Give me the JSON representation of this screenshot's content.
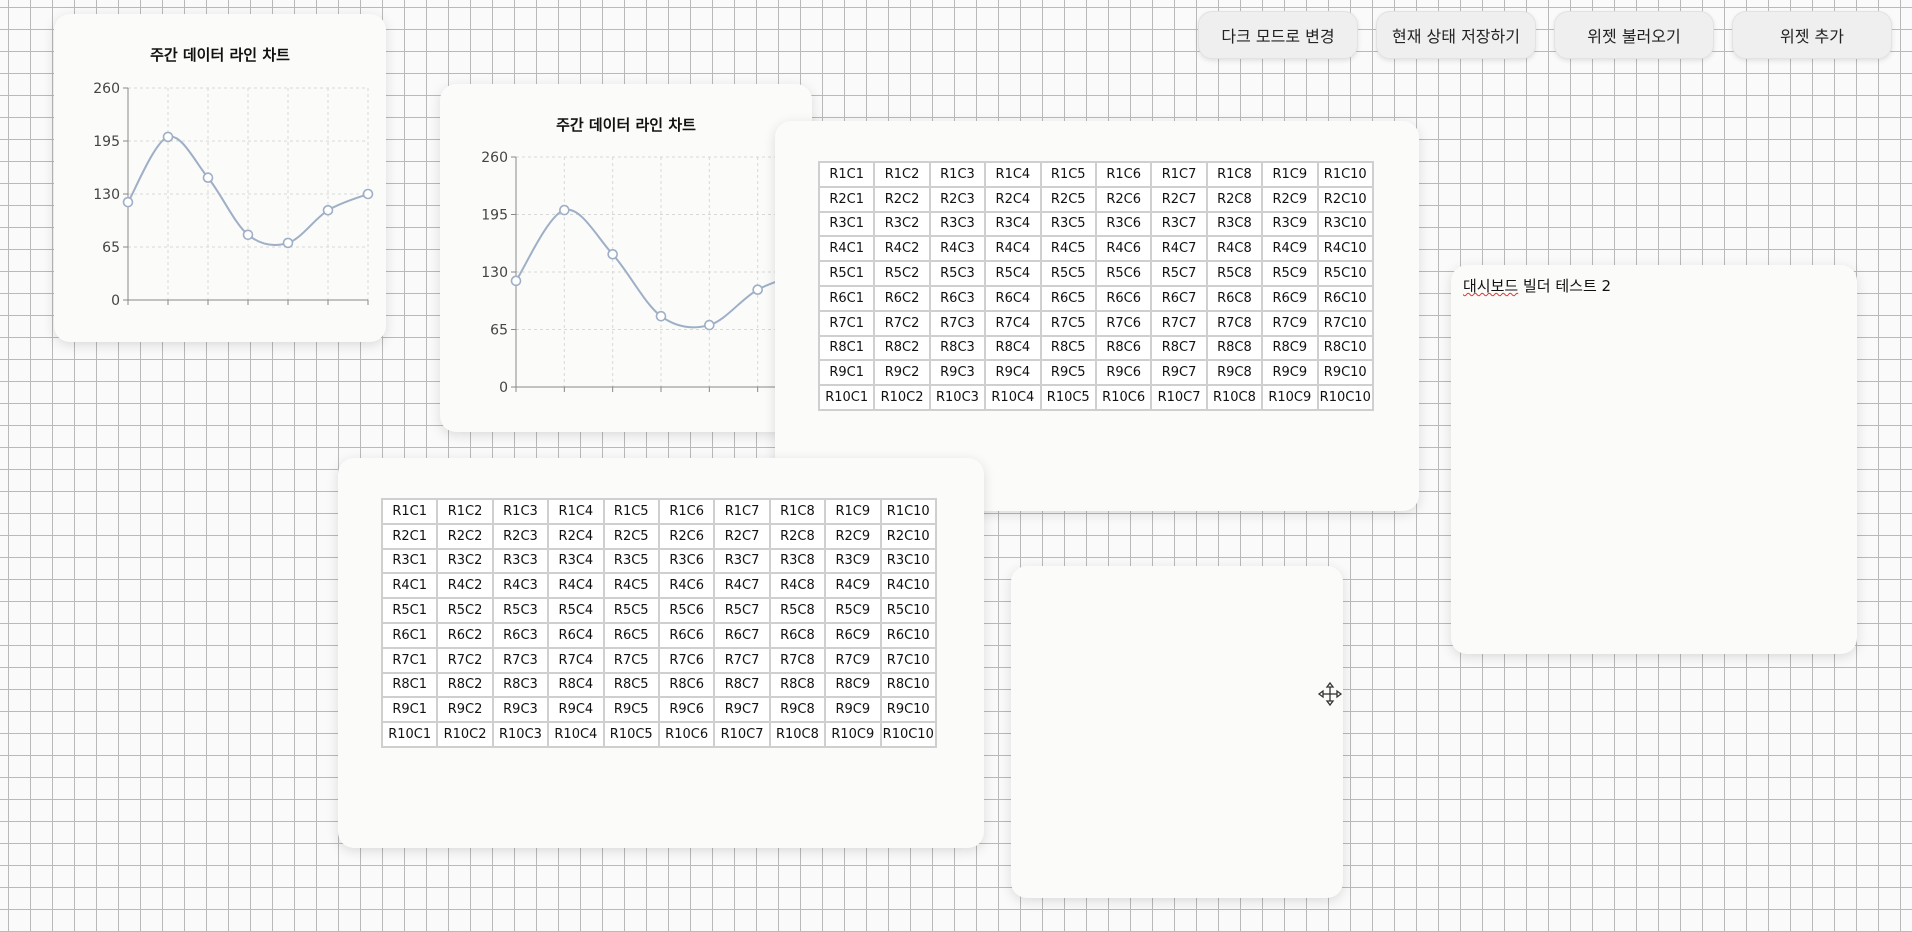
{
  "toolbar": {
    "dark_mode": "다크 모드로 변경",
    "save_state": "현재 상태 저장하기",
    "load_widgets": "위젯 불러오기",
    "add_widget": "위젯 추가"
  },
  "charts": [
    {
      "title": "주간 데이터 라인 차트",
      "chart_data": {
        "type": "line",
        "title": "주간 데이터 라인 차트",
        "x": [
          0,
          1,
          2,
          3,
          4,
          5,
          6
        ],
        "values": [
          120,
          200,
          150,
          80,
          70,
          110,
          130
        ],
        "yticks": [
          0,
          65,
          130,
          195,
          260
        ],
        "ylim": [
          0,
          260
        ],
        "grid": true,
        "line_color": "#9eafc6"
      }
    },
    {
      "title": "주간 데이터 라인 차트",
      "chart_data": {
        "type": "line",
        "title": "주간 데이터 라인 차트",
        "x": [
          0,
          1,
          2,
          3,
          4,
          5,
          6
        ],
        "values": [
          120,
          200,
          150,
          80,
          70,
          110,
          130
        ],
        "yticks": [
          0,
          65,
          130,
          195,
          260
        ],
        "ylim": [
          0,
          260
        ],
        "grid": true,
        "line_color": "#9eafc6"
      }
    }
  ],
  "tables": [
    {
      "rows": [
        [
          "R1C1",
          "R1C2",
          "R1C3",
          "R1C4",
          "R1C5",
          "R1C6",
          "R1C7",
          "R1C8",
          "R1C9",
          "R1C10"
        ],
        [
          "R2C1",
          "R2C2",
          "R2C3",
          "R2C4",
          "R2C5",
          "R2C6",
          "R2C7",
          "R2C8",
          "R2C9",
          "R2C10"
        ],
        [
          "R3C1",
          "R3C2",
          "R3C3",
          "R3C4",
          "R3C5",
          "R3C6",
          "R3C7",
          "R3C8",
          "R3C9",
          "R3C10"
        ],
        [
          "R4C1",
          "R4C2",
          "R4C3",
          "R4C4",
          "R4C5",
          "R4C6",
          "R4C7",
          "R4C8",
          "R4C9",
          "R4C10"
        ],
        [
          "R5C1",
          "R5C2",
          "R5C3",
          "R5C4",
          "R5C5",
          "R5C6",
          "R5C7",
          "R5C8",
          "R5C9",
          "R5C10"
        ],
        [
          "R6C1",
          "R6C2",
          "R6C3",
          "R6C4",
          "R6C5",
          "R6C6",
          "R6C7",
          "R6C8",
          "R6C9",
          "R6C10"
        ],
        [
          "R7C1",
          "R7C2",
          "R7C3",
          "R7C4",
          "R7C5",
          "R7C6",
          "R7C7",
          "R7C8",
          "R7C9",
          "R7C10"
        ],
        [
          "R8C1",
          "R8C2",
          "R8C3",
          "R8C4",
          "R8C5",
          "R8C6",
          "R8C7",
          "R8C8",
          "R8C9",
          "R8C10"
        ],
        [
          "R9C1",
          "R9C2",
          "R9C3",
          "R9C4",
          "R9C5",
          "R9C6",
          "R9C7",
          "R9C8",
          "R9C9",
          "R9C10"
        ],
        [
          "R10C1",
          "R10C2",
          "R10C3",
          "R10C4",
          "R10C5",
          "R10C6",
          "R10C7",
          "R10C8",
          "R10C9",
          "R10C10"
        ]
      ]
    },
    {
      "rows": [
        [
          "R1C1",
          "R1C2",
          "R1C3",
          "R1C4",
          "R1C5",
          "R1C6",
          "R1C7",
          "R1C8",
          "R1C9",
          "R1C10"
        ],
        [
          "R2C1",
          "R2C2",
          "R2C3",
          "R2C4",
          "R2C5",
          "R2C6",
          "R2C7",
          "R2C8",
          "R2C9",
          "R2C10"
        ],
        [
          "R3C1",
          "R3C2",
          "R3C3",
          "R3C4",
          "R3C5",
          "R3C6",
          "R3C7",
          "R3C8",
          "R3C9",
          "R3C10"
        ],
        [
          "R4C1",
          "R4C2",
          "R4C3",
          "R4C4",
          "R4C5",
          "R4C6",
          "R4C7",
          "R4C8",
          "R4C9",
          "R4C10"
        ],
        [
          "R5C1",
          "R5C2",
          "R5C3",
          "R5C4",
          "R5C5",
          "R5C6",
          "R5C7",
          "R5C8",
          "R5C9",
          "R5C10"
        ],
        [
          "R6C1",
          "R6C2",
          "R6C3",
          "R6C4",
          "R6C5",
          "R6C6",
          "R6C7",
          "R6C8",
          "R6C9",
          "R6C10"
        ],
        [
          "R7C1",
          "R7C2",
          "R7C3",
          "R7C4",
          "R7C5",
          "R7C6",
          "R7C7",
          "R7C8",
          "R7C9",
          "R7C10"
        ],
        [
          "R8C1",
          "R8C2",
          "R8C3",
          "R8C4",
          "R8C5",
          "R8C6",
          "R8C7",
          "R8C8",
          "R8C9",
          "R8C10"
        ],
        [
          "R9C1",
          "R9C2",
          "R9C3",
          "R9C4",
          "R9C5",
          "R9C6",
          "R9C7",
          "R9C8",
          "R9C9",
          "R9C10"
        ],
        [
          "R10C1",
          "R10C2",
          "R10C3",
          "R10C4",
          "R10C5",
          "R10C6",
          "R10C7",
          "R10C8",
          "R10C9",
          "R10C10"
        ]
      ]
    }
  ],
  "note": {
    "text_underlined": "대시보드",
    "text_rest": " 빌더 테스트 2"
  },
  "icons": {
    "move": "move-icon"
  }
}
